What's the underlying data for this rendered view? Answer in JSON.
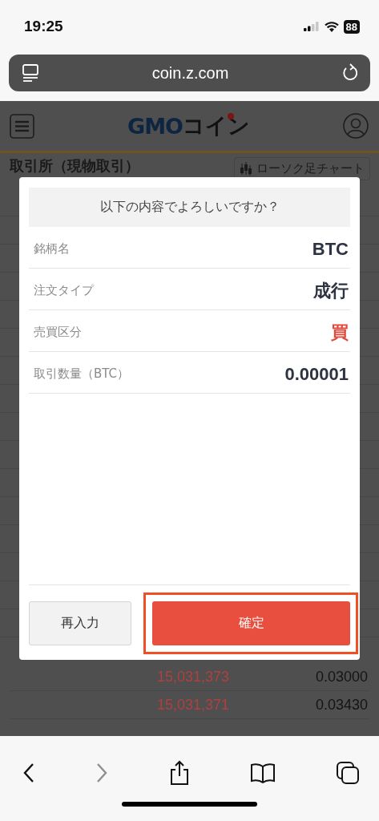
{
  "status_bar": {
    "time": "19:25",
    "battery": "88"
  },
  "browser": {
    "url": "coin.z.com",
    "toolbar": [
      {
        "kind": "back",
        "disabled": false
      },
      {
        "kind": "forward",
        "disabled": true
      },
      {
        "kind": "share",
        "disabled": false
      },
      {
        "kind": "bookmarks",
        "disabled": false
      },
      {
        "kind": "tabs",
        "disabled": false
      }
    ]
  },
  "page": {
    "logo": {
      "latin": "GMO",
      "kana": "コイン"
    },
    "title": "取引所（現物取引）",
    "chart_button": "ローソク足チャート",
    "rows": [
      {
        "price": "15,031,373",
        "amount": "0.03000"
      },
      {
        "price": "15,031,371",
        "amount": "0.03430"
      }
    ]
  },
  "dialog": {
    "question": "以下の内容でよろしいですか？",
    "fields": [
      {
        "label": "銘柄名",
        "value": "BTC",
        "kind": "plain"
      },
      {
        "label": "注文タイプ",
        "value": "成行",
        "kind": "plain"
      },
      {
        "label": "売買区分",
        "value": "買",
        "kind": "buy"
      },
      {
        "label": "取引数量（BTC）",
        "value": "0.00001",
        "kind": "plain"
      }
    ],
    "buttons": [
      {
        "label": "再入力",
        "kind": "secondary",
        "highlighted": false
      },
      {
        "label": "確定",
        "kind": "primary",
        "highlighted": true
      }
    ]
  }
}
